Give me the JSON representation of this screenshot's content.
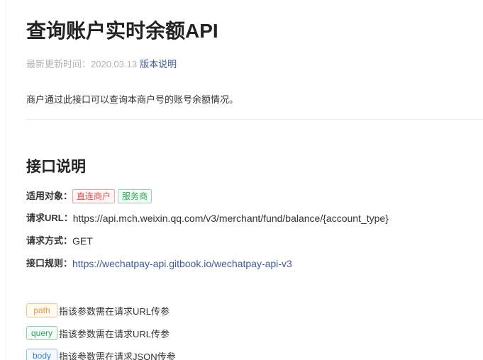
{
  "doc": {
    "title": "查询账户实时余额API",
    "meta": {
      "label": "最新更新时间：",
      "date": "2020.03.13",
      "link": "版本说明"
    },
    "intro": "商户通过此接口可以查询本商户号的账号余额情况。"
  },
  "api": {
    "section_title": "接口说明",
    "applicable_label": "适用对象：",
    "applicable_tags": [
      "直连商户",
      "服务商"
    ],
    "url_label": "请求URL：",
    "url_value": "https://api.mch.weixin.qq.com/v3/merchant/fund/balance/{account_type}",
    "method_label": "请求方式：",
    "method_value": "GET",
    "rule_label": "接口规则：",
    "rule_link": "https://wechatpay-api.gitbook.io/wechatpay-api-v3"
  },
  "param_legend": [
    {
      "tag": "path",
      "text": "指该参数需在请求URL传参",
      "color": "#e4973a"
    },
    {
      "tag": "query",
      "text": "指该参数需在请求URL传参",
      "color": "#2ea85a"
    },
    {
      "tag": "body",
      "text": "指该参数需在请求JSON传参",
      "color": "#3a7fcf"
    }
  ],
  "colors": {
    "link": "#3e5a95",
    "muted": "#b4b4b4",
    "tag_red": "#e05050",
    "tag_green": "#2ea85a"
  }
}
